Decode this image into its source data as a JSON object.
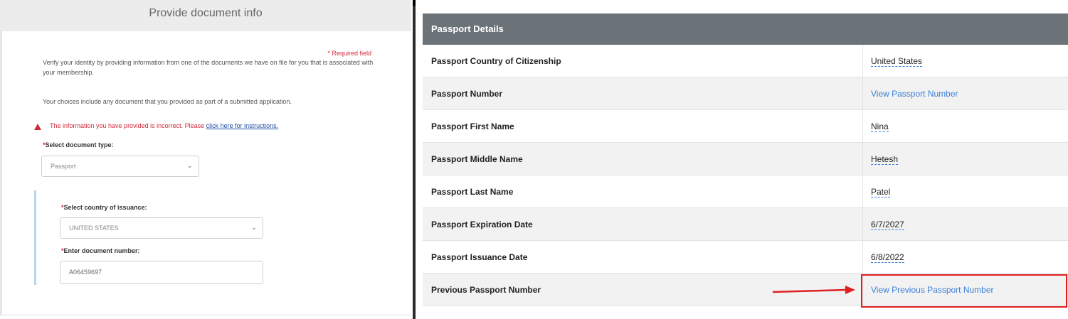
{
  "left_panel": {
    "title": "Provide document info",
    "required_note": "* Required field",
    "intro_text": "Verify your identity by providing information from one of the documents we have on file for you that is associated with your membership.",
    "choices_text": "Your choices include any document that you provided as part of a submitted application.",
    "error_text": "The information you have provided is incorrect. Please",
    "error_link": "click here for instructions.",
    "doc_type": {
      "label": "Select document type:",
      "value": "Passport"
    },
    "country": {
      "label": "Select country of issuance:",
      "value": "UNITED STATES"
    },
    "doc_number": {
      "label": "Enter document number:",
      "value": "A06459697"
    }
  },
  "passport_table": {
    "header": "Passport Details",
    "rows": [
      {
        "label": "Passport Country of Citizenship",
        "value": "United States"
      },
      {
        "label": "Passport Number",
        "value": "View Passport Number"
      },
      {
        "label": "Passport First Name",
        "value": "Nina"
      },
      {
        "label": "Passport Middle Name",
        "value": "Hetesh"
      },
      {
        "label": "Passport Last Name",
        "value": "Patel"
      },
      {
        "label": "Passport Expiration Date",
        "value": "6/7/2027"
      },
      {
        "label": "Passport Issuance Date",
        "value": "6/8/2022"
      },
      {
        "label": "Previous Passport Number",
        "value": "View Previous Passport Number"
      }
    ]
  },
  "colors": {
    "header_bg": "#6b7278",
    "link": "#3b7fd8",
    "error": "#d0293a",
    "annotation": "#e02020"
  },
  "icons": {
    "dropdown": "chevron-down-icon",
    "error": "warning-triangle-icon",
    "annotation": "red-arrow-icon"
  },
  "dropdown_glyph": "⌄"
}
